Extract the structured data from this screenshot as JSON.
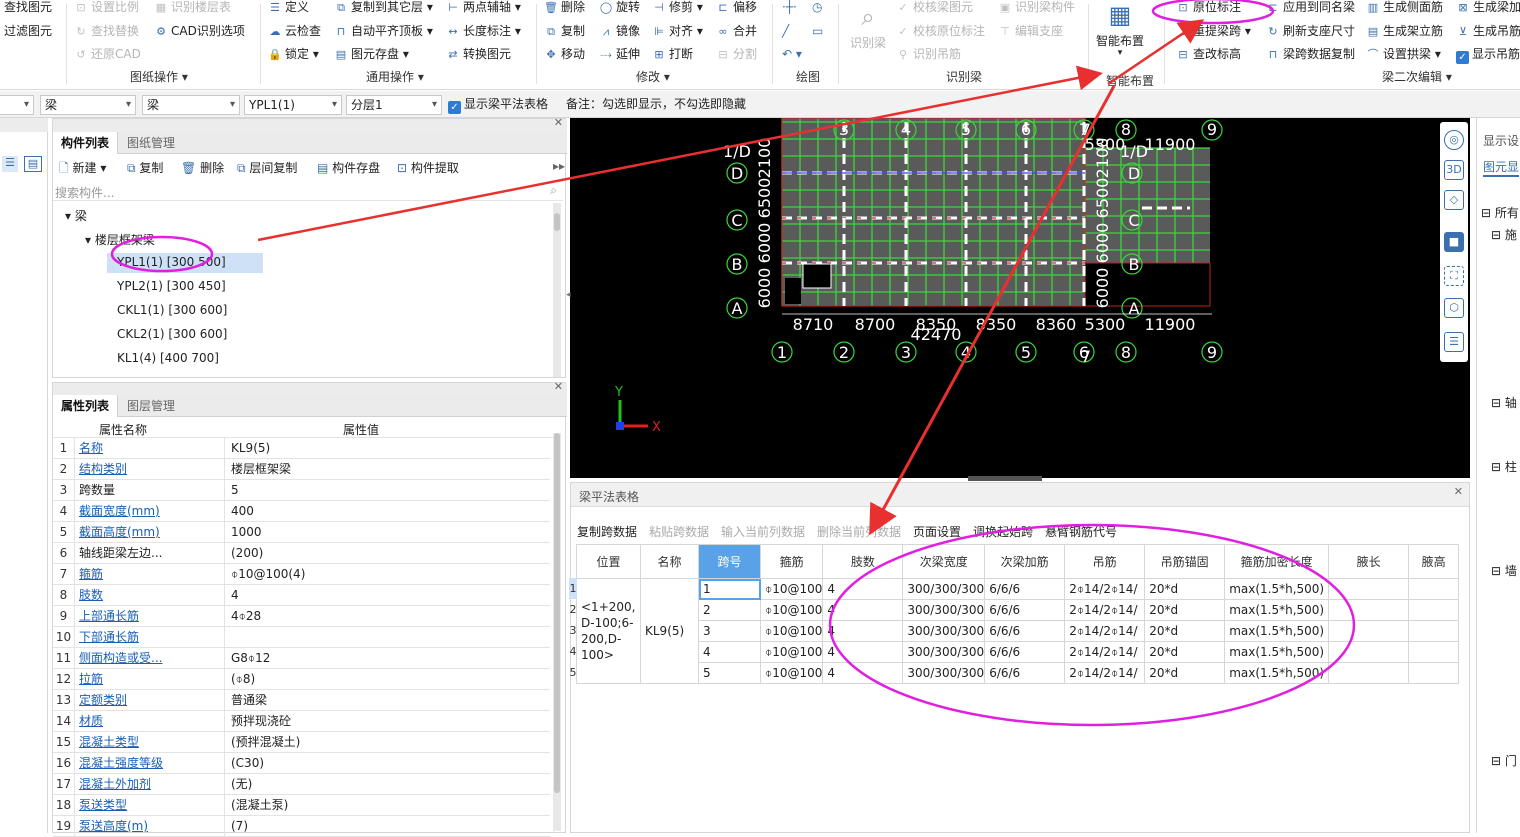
{
  "ribbon": {
    "col0": [
      "查找图元",
      "过滤图元"
    ],
    "col1": [
      "设置比例",
      "查找替换",
      "还原CAD"
    ],
    "col1b": [
      "识别楼层表",
      "CAD识别选项"
    ],
    "grp_drawing": "图纸操作",
    "col2": [
      "定义",
      "云检查",
      "锁定"
    ],
    "col2b": [
      "复制到其它层",
      "自动平齐顶板",
      "图元存盘"
    ],
    "col2c": [
      "两点辅轴",
      "长度标注",
      "转换图元"
    ],
    "grp_general": "通用操作",
    "col3": [
      "删除",
      "复制",
      "移动"
    ],
    "col3b": [
      "旋转",
      "镜像",
      "延伸"
    ],
    "col3c": [
      "修剪",
      "对齐",
      "打断"
    ],
    "col3d": [
      "偏移",
      "合并",
      "分割"
    ],
    "grp_modify": "修改",
    "grp_draw": "绘图",
    "recog_big": "识别梁",
    "col4": [
      "校核梁图元",
      "校核原位标注",
      "识别吊筋"
    ],
    "col4b": [
      "识别梁构件",
      "编辑支座"
    ],
    "grp_recog": "识别梁",
    "smart_big": "智能布置",
    "grp_smart": "智能布置",
    "col5": [
      "原位标注",
      "重提梁跨",
      "查改标高"
    ],
    "col5b": [
      "应用到同名梁",
      "刷新支座尺寸",
      "梁跨数据复制"
    ],
    "col5c": [
      "生成侧面筋",
      "生成架立筋",
      "设置拱梁"
    ],
    "col5d": [
      "生成梁加",
      "生成吊筋",
      "显示吊筋"
    ],
    "grp_beam2": "梁二次编辑"
  },
  "filterbar": {
    "sel1": "梁",
    "sel2": "梁",
    "sel3": "YPL1(1)",
    "sel4": "分层1",
    "show_table": "显示梁平法表格",
    "note": "备注：勾选即显示，不勾选即隐藏"
  },
  "comp_panel": {
    "tab1": "构件列表",
    "tab2": "图纸管理",
    "tools": [
      "新建",
      "复制",
      "删除",
      "层间复制",
      "构件存盘",
      "构件提取"
    ],
    "search_placeholder": "搜索构件...",
    "tree_root": "梁",
    "tree_group": "楼层框架梁",
    "items": [
      "YPL1(1) [300 500]",
      "YPL2(1) [300 450]",
      "CKL1(1) [300 600]",
      "CKL2(1) [300 600]",
      "KL1(4) [400 700]"
    ]
  },
  "prop_panel": {
    "tab1": "属性列表",
    "tab2": "图层管理",
    "col_name": "属性名称",
    "col_value": "属性值",
    "rows": [
      {
        "n": "1",
        "k": "名称",
        "v": "KL9(5)"
      },
      {
        "n": "2",
        "k": "结构类别",
        "v": "楼层框架梁"
      },
      {
        "n": "3",
        "k": "跨数量",
        "v": "5"
      },
      {
        "n": "4",
        "k": "截面宽度(mm)",
        "v": "400"
      },
      {
        "n": "5",
        "k": "截面高度(mm)",
        "v": "1000"
      },
      {
        "n": "6",
        "k": "轴线距梁左边...",
        "v": "(200)"
      },
      {
        "n": "7",
        "k": "箍筋",
        "v": "⌽10@100(4)"
      },
      {
        "n": "8",
        "k": "肢数",
        "v": "4"
      },
      {
        "n": "9",
        "k": "上部通长筋",
        "v": "4⌽28"
      },
      {
        "n": "10",
        "k": "下部通长筋",
        "v": ""
      },
      {
        "n": "11",
        "k": "侧面构造或受...",
        "v": "G8⌽12"
      },
      {
        "n": "12",
        "k": "拉筋",
        "v": "(⌽8)"
      },
      {
        "n": "13",
        "k": "定额类别",
        "v": "普通梁"
      },
      {
        "n": "14",
        "k": "材质",
        "v": "预拌现浇砼"
      },
      {
        "n": "15",
        "k": "混凝土类型",
        "v": "(预拌混凝土)"
      },
      {
        "n": "16",
        "k": "混凝土强度等级",
        "v": "(C30)"
      },
      {
        "n": "17",
        "k": "混凝土外加剂",
        "v": "(无)"
      },
      {
        "n": "18",
        "k": "泵送类型",
        "v": "(混凝土泵)"
      },
      {
        "n": "19",
        "k": "泵送高度(m)",
        "v": "(7)"
      }
    ]
  },
  "cad": {
    "top_axis": [
      "2",
      "3",
      "4",
      "5",
      "6",
      "7",
      "8",
      "9"
    ],
    "bottom_axis": [
      "1",
      "2",
      "3",
      "4",
      "5",
      "6",
      "7",
      "8",
      "9"
    ],
    "left_axis": [
      "1/D",
      "D",
      "C",
      "B",
      "A"
    ],
    "right_axis": [
      "1/D",
      "D",
      "C",
      "B",
      "A"
    ],
    "bottom_dims": [
      "8710",
      "8700",
      "8350",
      "8350",
      "8360",
      "5300",
      "11900"
    ],
    "total_dim": "42470",
    "top_dims": [
      "5300",
      "11900"
    ],
    "left_dims": [
      "6000",
      "6000",
      "6500",
      "2100"
    ],
    "right_dims": [
      "6000",
      "6000",
      "6500",
      "2100"
    ],
    "x_label": "X",
    "y_label": "Y"
  },
  "beam_table": {
    "title": "梁平法表格",
    "tools": [
      "复制跨数据",
      "粘贴跨数据",
      "输入当前列数据",
      "删除当前列数据",
      "页面设置",
      "调换起始跨",
      "悬臂钢筋代号"
    ],
    "headers": [
      "位置",
      "名称",
      "跨号",
      "箍筋",
      "肢数",
      "次梁宽度",
      "次梁加筋",
      "吊筋",
      "吊筋锚固",
      "箍筋加密长度",
      "腋长",
      "腋高"
    ],
    "position": "<1+200, D-100;6-200,D-100>",
    "name": "KL9(5)",
    "rows": [
      {
        "span": "1",
        "stirrup": "⌽10@100",
        "legs": "4",
        "sec_w": "300/300/300",
        "sec_add": "6/6/6",
        "hanger": "2⌽14/2⌽14/",
        "anchor": "20*d",
        "dense": "max(1.5*h,500)"
      },
      {
        "span": "2",
        "stirrup": "⌽10@100",
        "legs": "4",
        "sec_w": "300/300/300",
        "sec_add": "6/6/6",
        "hanger": "2⌽14/2⌽14/",
        "anchor": "20*d",
        "dense": "max(1.5*h,500)"
      },
      {
        "span": "3",
        "stirrup": "⌽10@100",
        "legs": "4",
        "sec_w": "300/300/300",
        "sec_add": "6/6/6",
        "hanger": "2⌽14/2⌽14/",
        "anchor": "20*d",
        "dense": "max(1.5*h,500)"
      },
      {
        "span": "4",
        "stirrup": "⌽10@100",
        "legs": "4",
        "sec_w": "300/300/300",
        "sec_add": "6/6/6",
        "hanger": "2⌽14/2⌽14/",
        "anchor": "20*d",
        "dense": "max(1.5*h,500)"
      },
      {
        "span": "5",
        "stirrup": "⌽10@100",
        "legs": "4",
        "sec_w": "300/300/300",
        "sec_add": "6/6/6",
        "hanger": "2⌽14/2⌽14/",
        "anchor": "20*d",
        "dense": "max(1.5*h,500)"
      }
    ]
  },
  "right_panel": {
    "title": "显示设",
    "tab": "图元显",
    "items": [
      "所有",
      "施",
      "轴",
      "柱",
      "墙",
      "门"
    ]
  },
  "colors": {
    "accent": "#2d7bd6",
    "annotation_magenta": "#e020e0",
    "annotation_red": "#e83030",
    "grid_green": "#3bd63b"
  }
}
